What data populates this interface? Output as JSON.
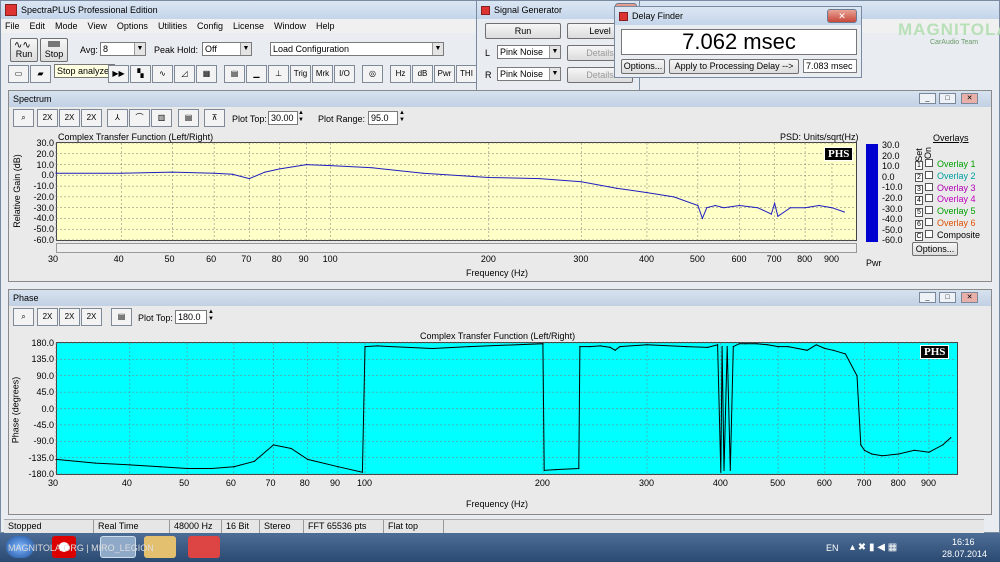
{
  "app": {
    "title": "SpectraPLUS Professional Edition",
    "menus": [
      "File",
      "Edit",
      "Mode",
      "View",
      "Options",
      "Utilities",
      "Config",
      "License",
      "Window",
      "Help"
    ]
  },
  "toolbar": {
    "run": "Run",
    "stop": "Stop",
    "avg_label": "Avg:",
    "avg_value": "8",
    "peak_hold_label": "Peak Hold:",
    "peak_hold_value": "Off",
    "config_value": "Load Configuration",
    "tooltip": "Stop analyzer",
    "row2": [
      "Trig",
      "Mrk",
      "I/O",
      "Hz",
      "dB",
      "Pwr",
      "THI"
    ]
  },
  "siggen": {
    "title": "Signal Generator",
    "run": "Run",
    "level": "Level",
    "details": "Details",
    "ch_l": "L",
    "ch_r": "R",
    "l_value": "Pink Noise",
    "r_value": "Pink Noise"
  },
  "delay": {
    "title": "Delay Finder",
    "value": "7.062 msec",
    "options": "Options...",
    "apply": "Apply to Processing Delay -->",
    "result": "7.083 msec"
  },
  "watermark": {
    "brand": "MAGNITOLA",
    "sub": "CarAudio Team"
  },
  "spectrum": {
    "title": "Spectrum",
    "plot_top_label": "Plot Top:",
    "plot_top_value": "30.00",
    "plot_range_label": "Plot Range:",
    "plot_range_value": "95.0",
    "buttons": [
      "2X",
      "2X",
      "2X"
    ],
    "psd": "PSD: Units/sqrt(Hz)",
    "badge": "PHS",
    "bar_label": "Pwr",
    "overlays_title": "Overlays",
    "overlay_hdr": [
      "Set",
      "On"
    ],
    "overlays": [
      {
        "n": "1",
        "name": "Overlay 1",
        "color": "#00a000"
      },
      {
        "n": "2",
        "name": "Overlay 2",
        "color": "#00a0a0"
      },
      {
        "n": "3",
        "name": "Overlay 3",
        "color": "#b000b0"
      },
      {
        "n": "4",
        "name": "Overlay 4",
        "color": "#c000c0"
      },
      {
        "n": "5",
        "name": "Overlay 5",
        "color": "#00a000"
      },
      {
        "n": "6",
        "name": "Overlay 6",
        "color": "#e05000"
      },
      {
        "n": "C",
        "name": "Composite",
        "color": "#000000"
      }
    ],
    "options": "Options..."
  },
  "phase": {
    "title": "Phase",
    "plot_top_label": "Plot Top:",
    "plot_top_value": "180.0",
    "badge": "PHS"
  },
  "status": [
    "Stopped",
    "Real Time",
    "48000 Hz",
    "16 Bit",
    "Stereo",
    "FFT 65536 pts",
    "Flat top"
  ],
  "taskbar": {
    "watermark": "MAGNITOLA.ORG | MIRO_LEGION",
    "lang": "EN",
    "time": "16:16",
    "date": "28.07.2014"
  },
  "colors": {
    "spectrum_bg": "#ffffc8",
    "phase_bg": "#00ffff",
    "trace": "#1f1fbf",
    "bar": "#0000d0"
  },
  "chart_data": [
    {
      "type": "line",
      "title": "Complex Transfer Function (Left/Right)",
      "xlabel": "Frequency (Hz)",
      "ylabel": "Relative Gain (dB)",
      "xscale": "log",
      "xlim": [
        30,
        1000
      ],
      "ylim": [
        -60,
        30
      ],
      "x_ticks": [
        "30",
        "40",
        "50",
        "60",
        "70",
        "80",
        "90",
        "100",
        "200",
        "300",
        "400",
        "500",
        "600",
        "700",
        "800",
        "900"
      ],
      "y_ticks": [
        "30.0",
        "20.0",
        "10.0",
        "0.0",
        "-10.0",
        "-20.0",
        "-30.0",
        "-40.0",
        "-50.0",
        "-60.0"
      ],
      "bar_ticks": [
        "30.0",
        "20.0",
        "10.0",
        "0.0",
        "-10.0",
        "-20.0",
        "-30.0",
        "-40.0",
        "-50.0",
        "-60.0"
      ],
      "series": [
        {
          "x": [
            30,
            40,
            50,
            60,
            65,
            70,
            75,
            80,
            90,
            100,
            120,
            150,
            200,
            250,
            300,
            350,
            400,
            450,
            500,
            510,
            520,
            540,
            560,
            600,
            650,
            690,
            700,
            710,
            750,
            800,
            850,
            900,
            950
          ],
          "y": [
            2,
            2,
            3,
            2,
            1,
            -3,
            3,
            6,
            10,
            9,
            7,
            2,
            -2,
            -3,
            -6,
            -12,
            -16,
            -20,
            -28,
            -40,
            -30,
            -28,
            -30,
            -28,
            -30,
            -36,
            -26,
            -38,
            -30,
            -30,
            -28,
            -30,
            -34
          ]
        }
      ]
    },
    {
      "type": "line",
      "title": "Complex Transfer Function (Left/Right)",
      "xlabel": "Frequency (Hz)",
      "ylabel": "Phase (degrees)",
      "xscale": "log",
      "xlim": [
        30,
        1000
      ],
      "ylim": [
        -180,
        180
      ],
      "x_ticks": [
        "30",
        "40",
        "50",
        "60",
        "70",
        "80",
        "90",
        "100",
        "200",
        "300",
        "400",
        "500",
        "600",
        "700",
        "800",
        "900"
      ],
      "y_ticks": [
        "180.0",
        "135.0",
        "90.0",
        "45.0",
        "0.0",
        "-45.0",
        "-90.0",
        "-135.0",
        "-180.0"
      ],
      "series": [
        {
          "x": [
            30,
            35,
            40,
            45,
            50,
            55,
            60,
            65,
            70,
            75,
            80,
            90,
            99,
            100,
            105,
            130,
            150,
            200,
            201,
            210,
            230,
            231,
            240,
            250,
            260,
            265,
            270,
            300,
            350,
            380,
            395,
            400,
            402,
            405,
            410,
            415,
            420,
            430,
            440,
            460,
            480,
            500,
            520,
            540,
            560,
            580,
            600,
            620,
            650,
            680,
            690,
            700,
            710,
            720,
            750,
            800,
            850,
            900,
            950,
            980
          ],
          "y": [
            -140,
            -150,
            -155,
            -160,
            -165,
            -165,
            -160,
            -145,
            -100,
            -110,
            -140,
            -160,
            -175,
            170,
            172,
            165,
            170,
            178,
            -170,
            -168,
            -165,
            170,
            170,
            172,
            168,
            160,
            170,
            175,
            170,
            168,
            175,
            -175,
            170,
            -170,
            170,
            -170,
            170,
            178,
            178,
            178,
            175,
            170,
            170,
            165,
            160,
            175,
            165,
            160,
            150,
            90,
            -100,
            -115,
            -120,
            -125,
            -130,
            -125,
            -115,
            -120,
            -100,
            -80
          ]
        }
      ]
    }
  ]
}
